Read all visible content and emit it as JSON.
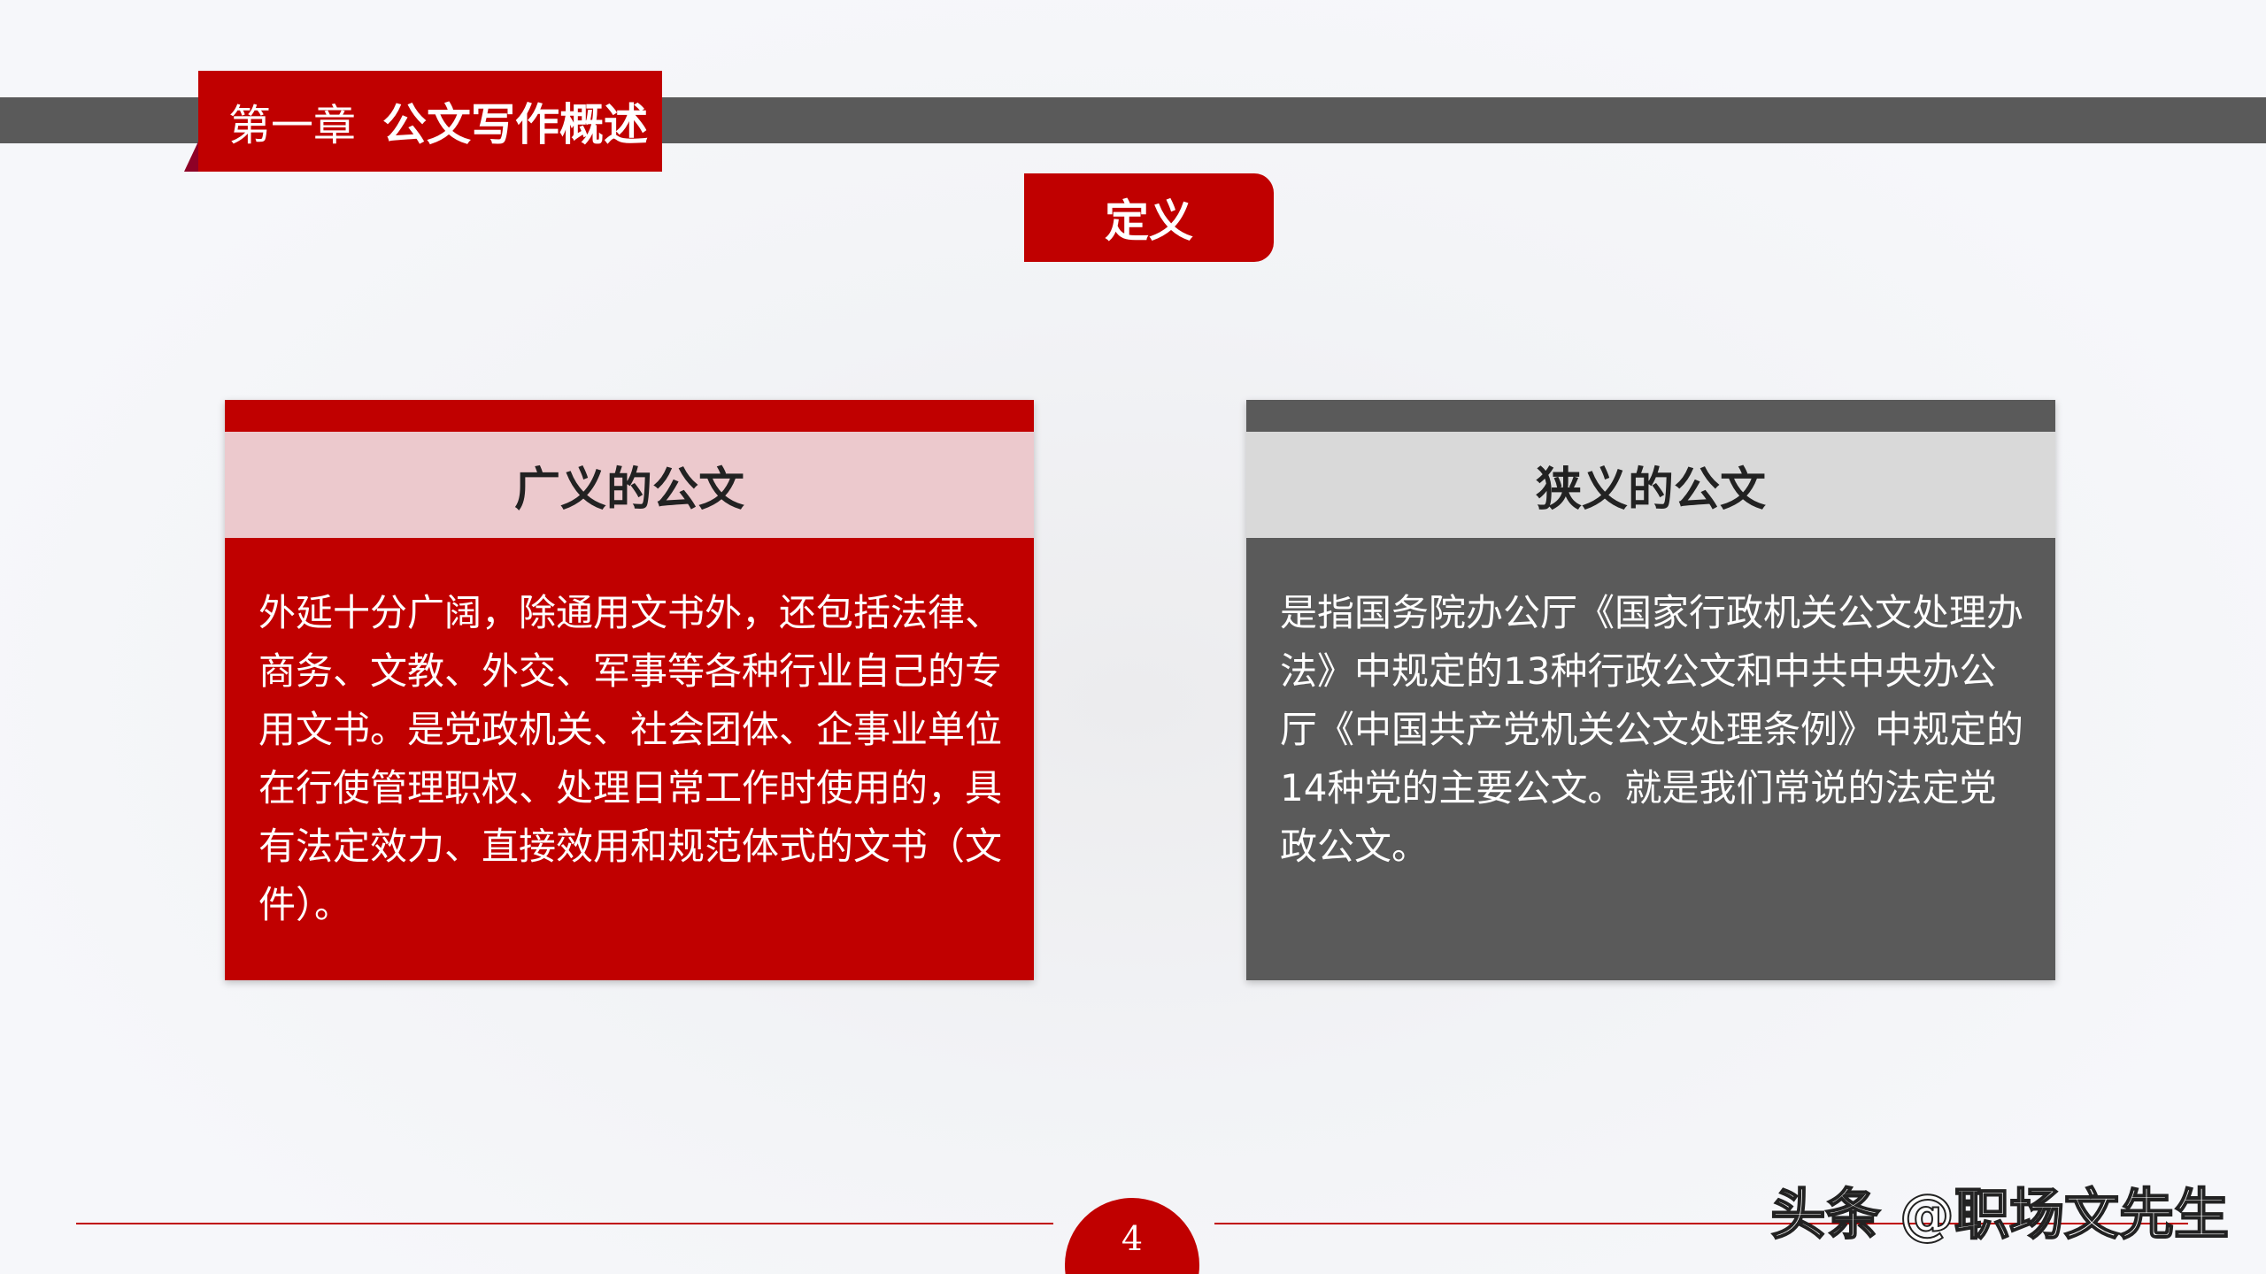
{
  "header": {
    "chapter_num": "第一章",
    "chapter_title": "公文写作概述"
  },
  "definition_tag": "定义",
  "cards": [
    {
      "title": "广义的公文",
      "body": "外延十分广阔，除通用文书外，还包括法律、商务、文教、外交、军事等各种行业自己的专用文书。是党政机关、社会团体、企事业单位在行使管理职权、处理日常工作时使用的，具有法定效力、直接效用和规范体式的文书（文件）。"
    },
    {
      "title": "狭义的公文",
      "body": "是指国务院办公厅《国家行政机关公文处理办法》中规定的13种行政公文和中共中央办公厅《中国共产党机关公文处理条例》中规定的14种党的主要公文。就是我们常说的法定党政公文。"
    }
  ],
  "footer": {
    "page_number": "4",
    "watermark": "头条 @职场文先生"
  },
  "colors": {
    "accent": "#c00000",
    "band": "#5a5a5a",
    "left_caption_bg": "#ecc9cd",
    "right_caption_bg": "#d9d9d9"
  }
}
